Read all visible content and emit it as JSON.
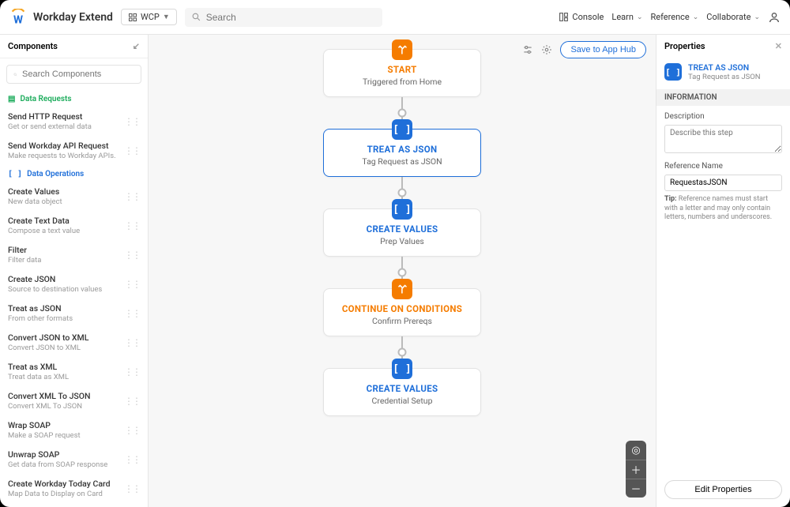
{
  "header": {
    "title": "Workday Extend",
    "wcp_label": "WCP",
    "search_placeholder": "Search",
    "console_label": "Console",
    "menus": [
      "Learn",
      "Reference",
      "Collaborate"
    ]
  },
  "sidebar": {
    "title": "Components",
    "search_placeholder": "Search Components",
    "data_requests_label": "Data Requests",
    "data_operations_label": "Data Operations",
    "requests": [
      {
        "title": "Send HTTP Request",
        "desc": "Get or send external data"
      },
      {
        "title": "Send Workday API Request",
        "desc": "Make requests to Workday APIs."
      }
    ],
    "operations": [
      {
        "title": "Create Values",
        "desc": "New data object"
      },
      {
        "title": "Create Text Data",
        "desc": "Compose a text value"
      },
      {
        "title": "Filter",
        "desc": "Filter data"
      },
      {
        "title": "Create JSON",
        "desc": "Source to destination values"
      },
      {
        "title": "Treat as JSON",
        "desc": "From other formats"
      },
      {
        "title": "Convert JSON to XML",
        "desc": "Convert JSON to XML"
      },
      {
        "title": "Treat as XML",
        "desc": "Treat data as XML"
      },
      {
        "title": "Convert XML To JSON",
        "desc": "Convert XML To JSON"
      },
      {
        "title": "Wrap SOAP",
        "desc": "Make a SOAP request"
      },
      {
        "title": "Unwrap SOAP",
        "desc": "Get data from SOAP response"
      },
      {
        "title": "Create Workday Today Card",
        "desc": "Map Data to Display on Card"
      }
    ]
  },
  "canvas": {
    "save_label": "Save to App Hub",
    "nodes": [
      {
        "title": "START",
        "sub": "Triggered from Home",
        "style": "orange",
        "icon": "branch"
      },
      {
        "title": "TREAT AS JSON",
        "sub": "Tag Request as JSON",
        "style": "blue",
        "icon": "brackets",
        "selected": true
      },
      {
        "title": "CREATE VALUES",
        "sub": "Prep Values",
        "style": "blue",
        "icon": "brackets"
      },
      {
        "title": "CONTINUE ON CONDITIONS",
        "sub": "Confirm Prereqs",
        "style": "orange",
        "icon": "branch"
      },
      {
        "title": "CREATE VALUES",
        "sub": "Credential Setup",
        "style": "blue",
        "icon": "brackets"
      }
    ]
  },
  "properties": {
    "title": "Properties",
    "node_title": "TREAT AS JSON",
    "node_sub": "Tag Request as JSON",
    "section_label": "INFORMATION",
    "desc_label": "Description",
    "desc_placeholder": "Describe this step",
    "ref_label": "Reference Name",
    "ref_value": "RequestasJSON",
    "tip_prefix": "Tip:",
    "tip_text": " Reference names must start with a letter and may only contain letters, numbers and underscores.",
    "edit_button": "Edit Properties"
  }
}
